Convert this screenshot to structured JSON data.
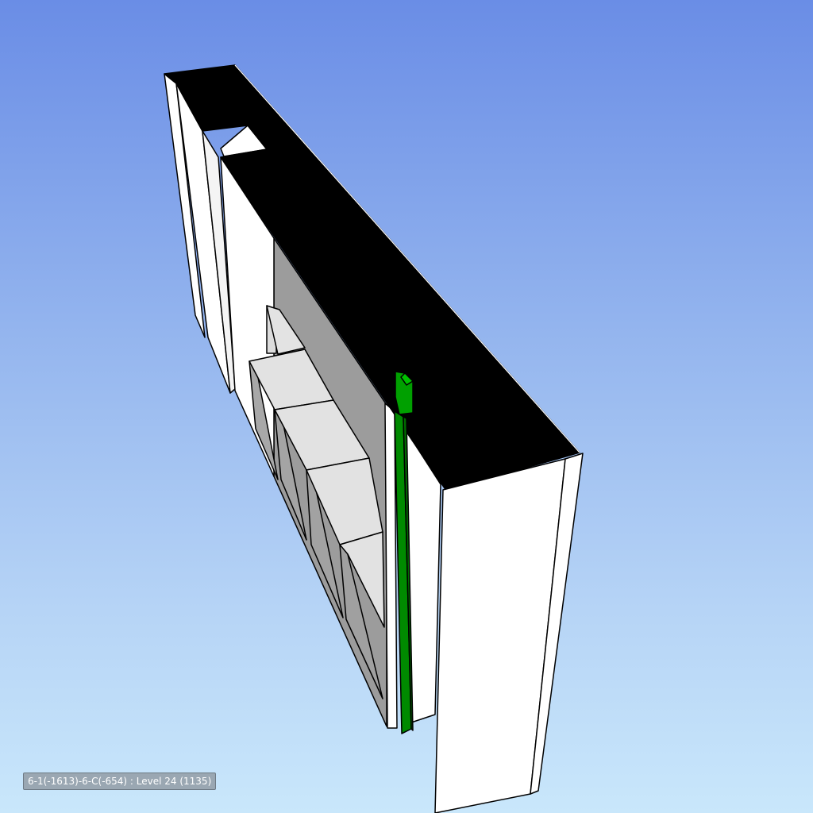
{
  "viewport": {
    "status_text": "6-1(-1613)-6-C(-654) : Level 24 (1135)"
  },
  "colors": {
    "sky_top": "#6a8de6",
    "sky_bottom": "#c9e7fb",
    "top_face": "#000000",
    "side_face": "#ffffff",
    "shelf_face": "#e2e2e2",
    "shelf_shadow": "#a0a0a0",
    "selected_member": "#008a00"
  }
}
